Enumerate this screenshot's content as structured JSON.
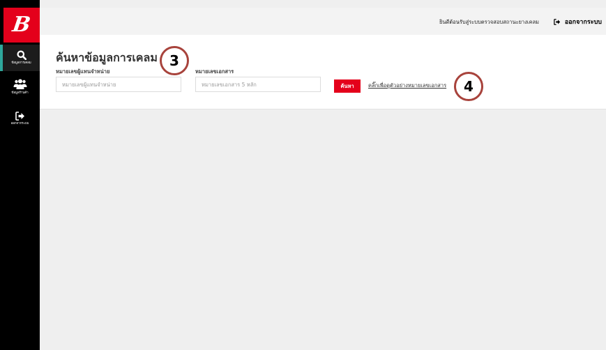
{
  "sidebar": {
    "logo_letter": "B",
    "items": [
      {
        "label": "ข้อมูลการเคลม",
        "icon": "search-icon",
        "active": true
      },
      {
        "label": "ข้อมูลร้านค้า",
        "icon": "users-icon",
        "active": false
      },
      {
        "label": "ออกจากระบบ",
        "icon": "sign-out-icon",
        "active": false
      }
    ]
  },
  "header": {
    "welcome_text": "ยินดีต้อนรับสู่ระบบตรวจสอบสถานะยางเคลม",
    "logout_label": "ออกจากระบบ"
  },
  "search_form": {
    "title": "ค้นหาข้อมูลการเคลม",
    "dealer_label": "หมายเลขผู้แทนจำหน่าย",
    "dealer_placeholder": "หมายเลขผู้แทนจำหน่าย",
    "doc_label": "หมายเลขเอกสาร",
    "doc_placeholder": "หมายเลขเอกสาร 5 หลัก",
    "search_button": "ค้นหา",
    "sample_link": "คลิ๊กเพื่อดูตัวอย่างหมายเลขเอกสาร"
  },
  "annotations": {
    "callout_3": "3",
    "callout_4": "4"
  },
  "colors": {
    "brand_red": "#e4001b",
    "active_accent": "#2ea79b",
    "sidebar_bg": "#000000",
    "callout_border": "#a8433c"
  }
}
